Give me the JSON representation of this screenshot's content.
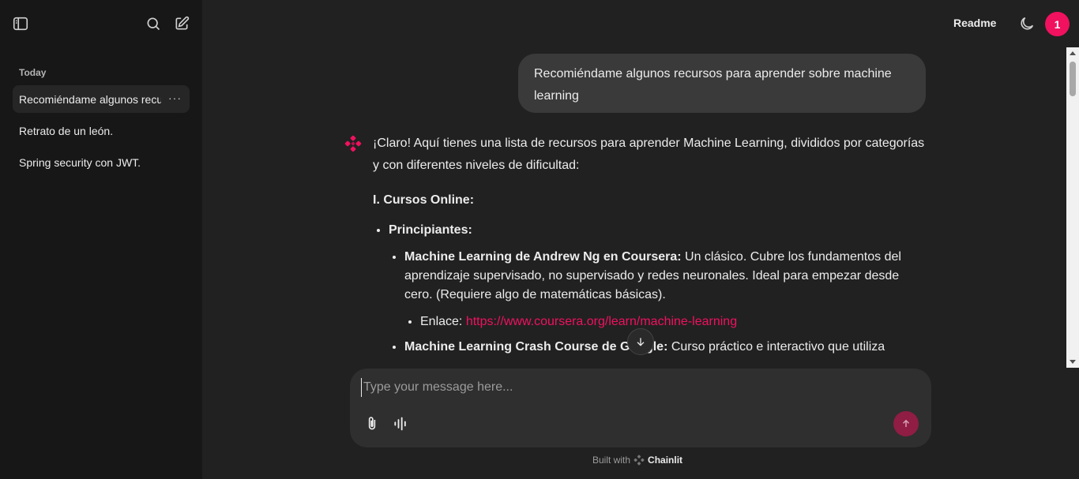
{
  "sidebar": {
    "section_label": "Today",
    "threads": [
      {
        "label": "Recomiéndame algunos recursos para aprender sobre machine learning"
      },
      {
        "label": "Retrato de un león."
      },
      {
        "label": "Spring security con JWT."
      }
    ],
    "more_label": "···"
  },
  "header": {
    "readme_label": "Readme",
    "avatar_initial": "1",
    "avatar_color": "#f0115f"
  },
  "chat": {
    "user_message": "Recomiéndame algunos recursos para aprender sobre machine learning",
    "assistant": {
      "intro": "¡Claro! Aquí tienes una lista de recursos para aprender Machine Learning, divididos por categorías y con diferentes niveles de dificultad:",
      "section_heading": "I. Cursos Online:",
      "level_label": "Principiantes:",
      "course1_title": "Machine Learning de Andrew Ng en Coursera:",
      "course1_desc": " Un clásico. Cubre los fundamentos del aprendizaje supervisado, no supervisado y redes neuronales. Ideal para empezar desde cero. (Requiere algo de matemáticas básicas).",
      "course1_link_label": "Enlace: ",
      "course1_link": "https://www.coursera.org/learn/machine-learning",
      "course2_title": "Machine Learning Crash Course de Google:",
      "course2_desc": " Curso práctico e interactivo que utiliza"
    }
  },
  "composer": {
    "placeholder": "Type your message here..."
  },
  "footer": {
    "built_with": "Built with",
    "brand": "Chainlit"
  },
  "colors": {
    "accent": "#f0115f",
    "link": "#f0115f",
    "send_button": "#8f1d44"
  }
}
